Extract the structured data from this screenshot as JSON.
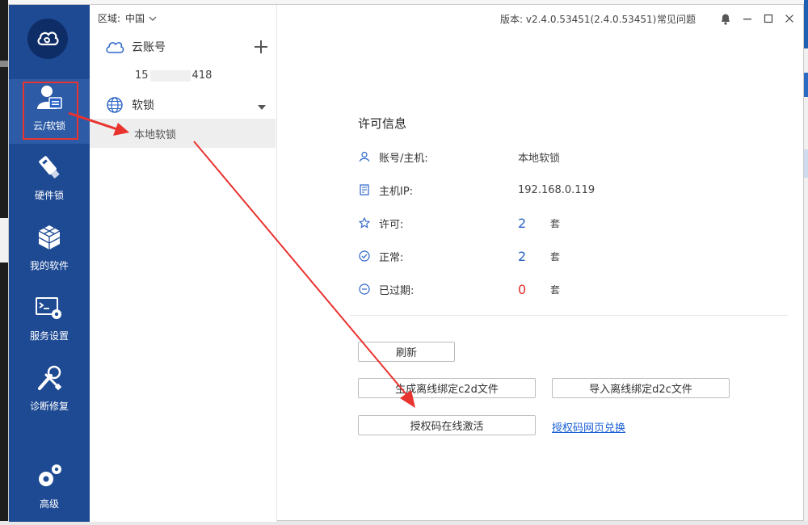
{
  "titlebar": {
    "region_label": "区域:",
    "region_value": "中国",
    "version": "版本: v2.4.0.53451(2.4.0.53451)",
    "faq": "常见问题"
  },
  "nav": {
    "items": [
      {
        "label": "云/软锁",
        "icon": "cloud-user-icon"
      },
      {
        "label": "硬件锁",
        "icon": "usb-key-icon"
      },
      {
        "label": "我的软件",
        "icon": "cubes-icon"
      },
      {
        "label": "服务设置",
        "icon": "terminal-gear-icon"
      },
      {
        "label": "诊断修复",
        "icon": "tools-icon"
      },
      {
        "label": "高级",
        "icon": "gears-icon"
      }
    ]
  },
  "tree": {
    "cloud_account": "云账号",
    "account_prefix": "15",
    "account_suffix": "418",
    "soft_lock": "软锁",
    "local_soft_lock": "本地软锁"
  },
  "license": {
    "title": "许可信息",
    "rows": [
      {
        "label": "账号/主机:",
        "value": "本地软锁",
        "icon": "user-icon"
      },
      {
        "label": "主机IP:",
        "value": "192.168.0.119",
        "icon": "server-icon"
      },
      {
        "label": "许可:",
        "value": "2",
        "unit": "套",
        "icon": "star-icon"
      },
      {
        "label": "正常:",
        "value": "2",
        "unit": "套",
        "icon": "check-circle-icon"
      },
      {
        "label": "已过期:",
        "value": "0",
        "unit": "套",
        "icon": "minus-circle-icon"
      }
    ]
  },
  "actions": {
    "refresh": "刷新",
    "generate_c2d": "生成离线绑定c2d文件",
    "import_d2c": "导入离线绑定d2c文件",
    "activate_online": "授权码在线激活",
    "web_redeem": "授权码网页兑换"
  },
  "colors": {
    "nav_bg": "#1e4a94",
    "accent_blue": "#2a63c7",
    "link_blue": "#1a5fd6",
    "expired_red": "#e42c2c",
    "annotation_red": "#e8332f"
  }
}
